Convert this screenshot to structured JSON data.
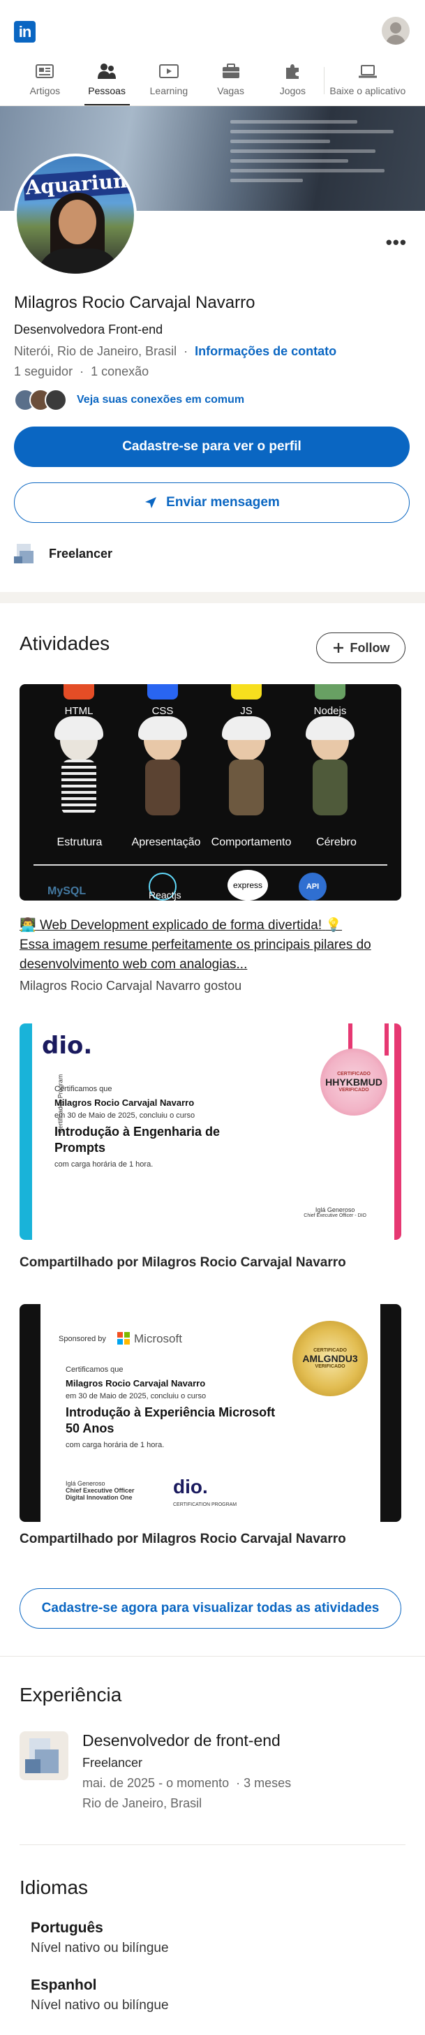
{
  "brand": {
    "logo_text": "in"
  },
  "nav": {
    "tabs": [
      {
        "label": "Artigos",
        "icon": "articles-icon"
      },
      {
        "label": "Pessoas",
        "icon": "people-icon",
        "active": true
      },
      {
        "label": "Learning",
        "icon": "learning-icon"
      },
      {
        "label": "Vagas",
        "icon": "jobs-icon"
      },
      {
        "label": "Jogos",
        "icon": "games-icon"
      },
      {
        "label": "Baixe o aplicativo",
        "icon": "laptop-icon"
      }
    ]
  },
  "cover": {
    "photo_sign_text": "Aquarium"
  },
  "profile": {
    "name": "Milagros Rocio Carvajal Navarro",
    "headline": "Desenvolvedora Front-end",
    "location": "Niterói, Rio de Janeiro, Brasil",
    "contact_link": "Informações de contato",
    "followers": "1 seguidor",
    "connections": "1 conexão",
    "mutual_text": "Veja suas conexões em comum",
    "signup_button": "Cadastre-se para ver o perfil",
    "message_button": "Enviar mensagem",
    "current_company": "Freelancer",
    "more_menu": "•••"
  },
  "activities": {
    "title": "Atividades",
    "follow_button": "Follow",
    "post1": {
      "image": {
        "columns": [
          "HTML",
          "CSS",
          "JS",
          "Nodejs"
        ],
        "sub_labels": [
          "Estrutura",
          "Apresentação",
          "Comportamento",
          "Cérebro"
        ],
        "bottom_items": [
          "MySQL",
          "Reactjs",
          "express",
          "API"
        ]
      },
      "title": "Web Development explicado de forma divertida!",
      "title_line2": "Essa imagem resume perfeitamente os principais pilares do desenvolvimento web com analogias...",
      "emoji_left": "👨‍💻",
      "emoji_right": "💡",
      "liked_by": "Milagros Rocio Carvajal Navarro gostou"
    },
    "post2": {
      "cert": {
        "brand": "dio.",
        "side_label": "Certificados Program",
        "certify": "Certificamos que",
        "name": "Milagros Rocio Carvajal Navarro",
        "date_line": "em 30 de Maio de 2025, concluiu o curso",
        "course": "Introdução à Engenharia de Prompts",
        "hours": "com carga horária de 1 hora.",
        "seal_code": "HHYKBMUD",
        "seal_top": "CERTIFICADO",
        "seal_bottom": "VERIFICADO",
        "signer": "Iglá Generoso",
        "signer_role": "Chief Executive Officer - DIO"
      },
      "shared_by": "Compartilhado por Milagros Rocio Carvajal Navarro"
    },
    "post3": {
      "cert": {
        "sponsor_label": "Sponsored by",
        "sponsor": "Microsoft",
        "certify": "Certificamos que",
        "name": "Milagros Rocio Carvajal Navarro",
        "date_line": "em 30 de Maio de 2025, concluiu o curso",
        "course": "Introdução à Experiência Microsoft 50 Anos",
        "hours": "com carga horária de 1 hora.",
        "seal_code": "AMLGNDU3",
        "seal_top": "CERTIFICADO",
        "seal_bottom": "VERIFICADO",
        "signer": "Iglá Generoso",
        "signer_role": "Chief Executive Officer",
        "signer_role2": "Digital Innovation One",
        "brand": "dio.",
        "program": "CERTIFICATION PROGRAM"
      },
      "shared_by": "Compartilhado por Milagros Rocio Carvajal Navarro"
    },
    "cta_button": "Cadastre-se agora para visualizar todas as atividades"
  },
  "experience": {
    "title": "Experiência",
    "items": [
      {
        "role": "Desenvolvedor de front-end",
        "company": "Freelancer",
        "period": "mai. de 2025 - o momento",
        "duration": "3 meses",
        "location": "Rio de Janeiro, Brasil"
      }
    ]
  },
  "languages": {
    "title": "Idiomas",
    "items": [
      {
        "name": "Português",
        "level": "Nível nativo ou bilíngue"
      },
      {
        "name": "Espanhol",
        "level": "Nível nativo ou bilíngue"
      }
    ]
  },
  "colors": {
    "linkedin_blue": "#0a66c2",
    "dio_cyan": "#19b3d9",
    "dio_pink": "#e63872",
    "seal_gold": "#d4a72c"
  }
}
